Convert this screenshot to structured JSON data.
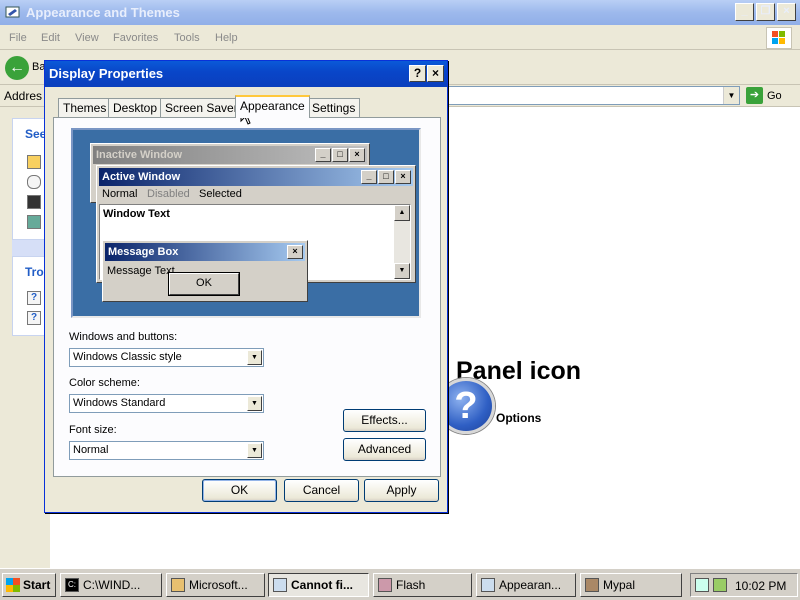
{
  "explorer": {
    "title": "Appearance and Themes",
    "menu": [
      "File",
      "Edit",
      "View",
      "Favorites",
      "Tools",
      "Help"
    ],
    "back_label": "Ba",
    "address_label": "Addres",
    "go_label": "Go",
    "left_panel": {
      "see_heading": "See",
      "trouble_heading": "Tro"
    },
    "main": {
      "panel_icon_title": "Panel icon",
      "options_text": "Options"
    }
  },
  "dialog": {
    "title": "Display Properties",
    "help_btn": "?",
    "close_btn": "×",
    "tabs": [
      {
        "label": "Themes"
      },
      {
        "label": "Desktop"
      },
      {
        "label": "Screen Saver"
      },
      {
        "label": "Appearance",
        "active": true
      },
      {
        "label": "Settings"
      }
    ],
    "preview": {
      "inactive_title": "Inactive Window",
      "active_title": "Active Window",
      "menu": [
        "Normal",
        "Disabled",
        "Selected"
      ],
      "window_text": "Window Text",
      "msgbox_title": "Message Box",
      "msgbox_text": "Message Text",
      "msgbox_ok": "OK"
    },
    "windows_buttons": {
      "label": "Windows and buttons:",
      "value": "Windows Classic style"
    },
    "color_scheme": {
      "label": "Color scheme:",
      "value": "Windows Standard"
    },
    "font_size": {
      "label": "Font size:",
      "value": "Normal"
    },
    "effects_btn": "Effects...",
    "advanced_btn": "Advanced",
    "ok_btn": "OK",
    "cancel_btn": "Cancel",
    "apply_btn": "Apply"
  },
  "taskbar": {
    "start": "Start",
    "tasks": [
      {
        "label": "C:\\WIND...",
        "icon": "console-icon"
      },
      {
        "label": "Microsoft...",
        "icon": "msi-icon"
      },
      {
        "label": "Cannot fi...",
        "icon": "explorer-icon",
        "active": true
      },
      {
        "label": "Flash",
        "icon": "flash-icon"
      },
      {
        "label": "Appearan...",
        "icon": "explorer-icon"
      },
      {
        "label": "Mypal",
        "icon": "mypal-icon"
      }
    ],
    "clock": "10:02 PM"
  },
  "colors": {
    "xp_blue_title": "#0a46c9",
    "preview_desktop": "#3a6ea5",
    "active_tab_accent": "#ffc83c"
  }
}
